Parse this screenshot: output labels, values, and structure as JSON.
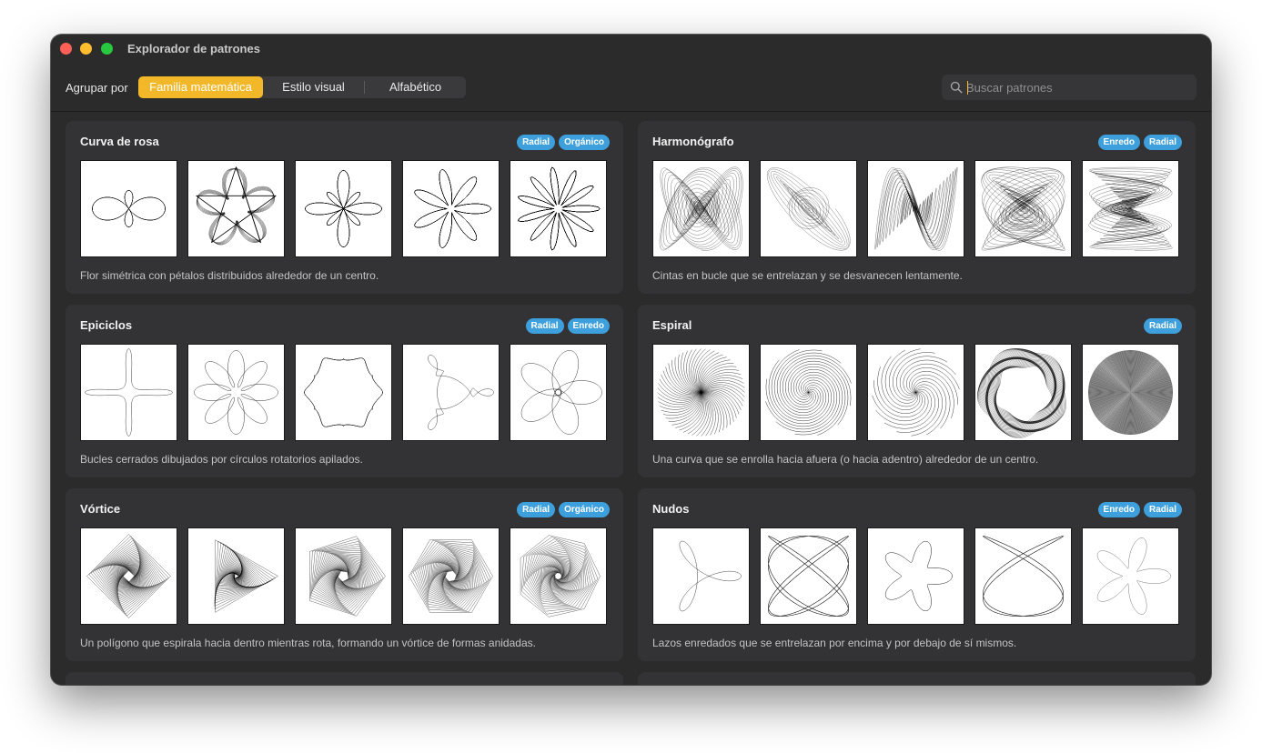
{
  "window": {
    "title": "Explorador de patrones"
  },
  "toolbar": {
    "group_label": "Agrupar por",
    "segments": [
      "Familia matemática",
      "Estilo visual",
      "Alfabético"
    ],
    "selected_segment": "Familia matemática",
    "search_placeholder": "Buscar patrones",
    "search_value": ""
  },
  "colors": {
    "accent": "#f2b82a",
    "tag": "#3da0dc",
    "window_bg": "#2b2b2c",
    "card_bg": "#333335"
  },
  "cards": [
    {
      "title": "Curva de rosa",
      "tags": [
        "Radial",
        "Orgánico"
      ],
      "description": "Flor simétrica con pétalos distribuidos alrededor de un centro."
    },
    {
      "title": "Harmonógrafo",
      "tags": [
        "Enredo",
        "Radial"
      ],
      "description": "Cintas en bucle que se entrelazan y se desvanecen lentamente."
    },
    {
      "title": "Epiciclos",
      "tags": [
        "Radial",
        "Enredo"
      ],
      "description": "Bucles cerrados dibujados por círculos rotatorios apilados."
    },
    {
      "title": "Espiral",
      "tags": [
        "Radial"
      ],
      "description": "Una curva que se enrolla hacia afuera (o hacia adentro) alrededor de un centro."
    },
    {
      "title": "Vórtice",
      "tags": [
        "Radial",
        "Orgánico"
      ],
      "description": "Un polígono que espirala hacia dentro mientras rota, formando un vórtice de formas anidadas."
    },
    {
      "title": "Nudos",
      "tags": [
        "Enredo",
        "Radial"
      ],
      "description": "Lazos enredados que se entrelazan por encima y por debajo de sí mismos."
    }
  ]
}
